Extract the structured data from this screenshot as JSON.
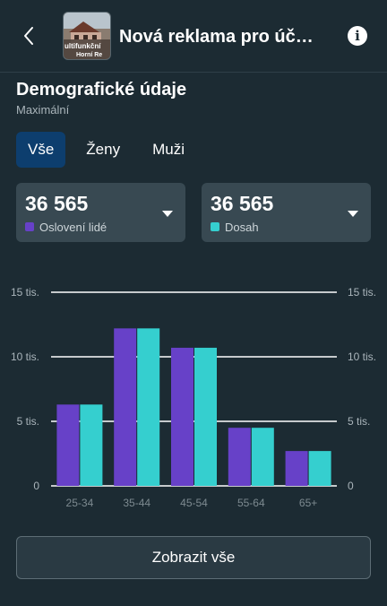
{
  "header": {
    "title": "Nová reklama pro účel…",
    "thumbnail_text": [
      "ultifunkční",
      "Horní Re"
    ]
  },
  "section": {
    "title": "Demografické údaje",
    "subtitle": "Maximální"
  },
  "tabs": [
    {
      "label": "Vše",
      "active": true
    },
    {
      "label": "Ženy",
      "active": false
    },
    {
      "label": "Muži",
      "active": false
    }
  ],
  "metrics": [
    {
      "value": "36 565",
      "label": "Oslovení lidé",
      "color": "#6741c8"
    },
    {
      "value": "36 565",
      "label": "Dosah",
      "color": "#35cfcf"
    }
  ],
  "chart_data": {
    "type": "bar",
    "categories": [
      "25-34",
      "35-44",
      "45-54",
      "55-64",
      "65+"
    ],
    "series": [
      {
        "name": "Oslovení lidé",
        "color": "#6741c8",
        "values": [
          6300,
          12200,
          10700,
          4500,
          2700
        ]
      },
      {
        "name": "Dosah",
        "color": "#35cfcf",
        "values": [
          6300,
          12200,
          10700,
          4500,
          2700
        ]
      }
    ],
    "ylim": [
      0,
      15000
    ],
    "y_ticks": [
      {
        "value": 0,
        "label": "0"
      },
      {
        "value": 5000,
        "label": "5 tis."
      },
      {
        "value": 10000,
        "label": "10 tis."
      },
      {
        "value": 15000,
        "label": "15 tis."
      }
    ],
    "grid": true,
    "y_axis_both_sides": true
  },
  "footer": {
    "show_all_label": "Zobrazit vše"
  }
}
